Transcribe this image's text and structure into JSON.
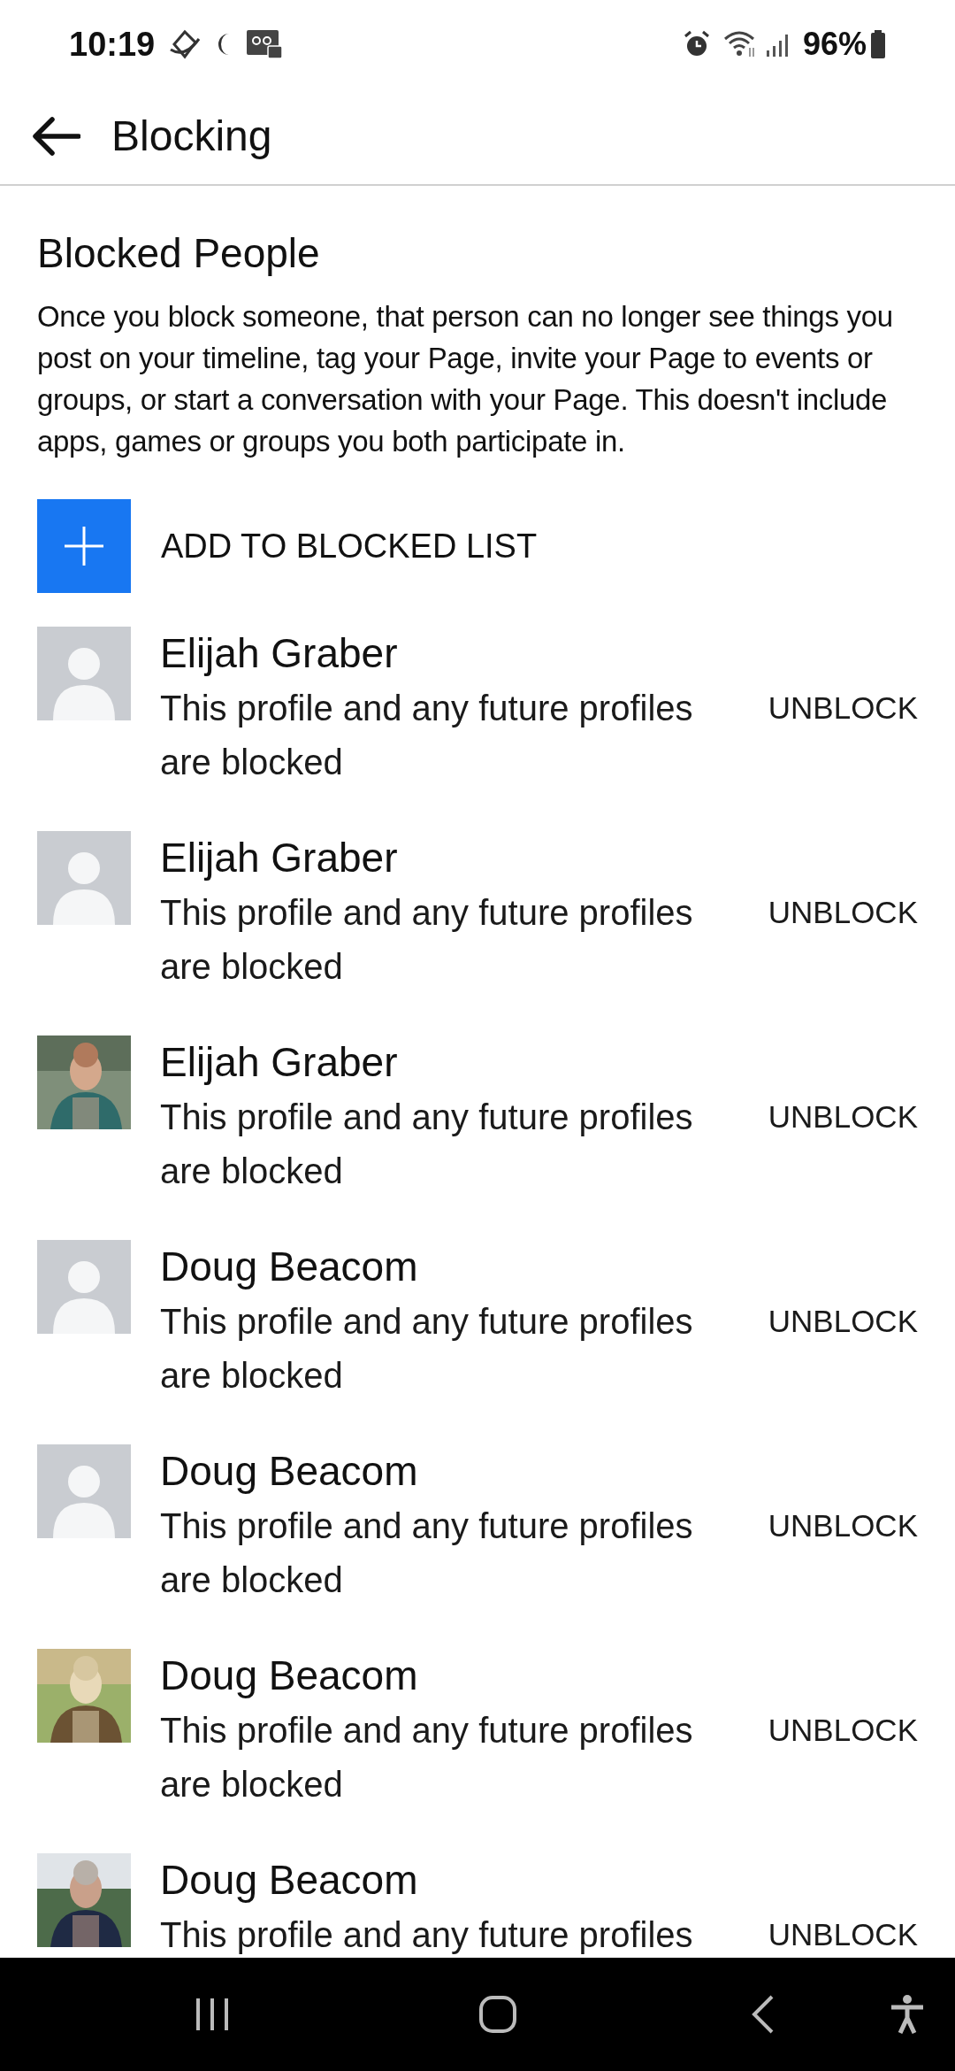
{
  "status_bar": {
    "time": "10:19",
    "battery": "96%"
  },
  "header": {
    "title": "Blocking"
  },
  "section": {
    "title": "Blocked People",
    "description": "Once you block someone, that person can no longer see things you post on your timeline, tag your Page, invite your Page to events or groups, or start a conversation with your Page. This doesn't include apps, games or groups you both participate in."
  },
  "add_button": {
    "label": "ADD TO BLOCKED LIST"
  },
  "blocked": [
    {
      "name": "Elijah Graber",
      "subtitle": "This profile and any future profiles are blocked",
      "action": "UNBLOCK",
      "kind": "placeholder"
    },
    {
      "name": "Elijah Graber",
      "subtitle": "This profile and any future profiles are blocked",
      "action": "UNBLOCK",
      "kind": "placeholder"
    },
    {
      "name": "Elijah Graber",
      "subtitle": "This profile and any future profiles are blocked",
      "action": "UNBLOCK",
      "kind": "picture"
    },
    {
      "name": "Doug Beacom",
      "subtitle": "This profile and any future profiles are blocked",
      "action": "UNBLOCK",
      "kind": "placeholder"
    },
    {
      "name": "Doug Beacom",
      "subtitle": "This profile and any future profiles are blocked",
      "action": "UNBLOCK",
      "kind": "placeholder"
    },
    {
      "name": "Doug Beacom",
      "subtitle": "This profile and any future profiles are blocked",
      "action": "UNBLOCK",
      "kind": "picture"
    },
    {
      "name": "Doug Beacom",
      "subtitle": "This profile and any future profiles",
      "action": "UNBLOCK",
      "kind": "picture"
    }
  ]
}
